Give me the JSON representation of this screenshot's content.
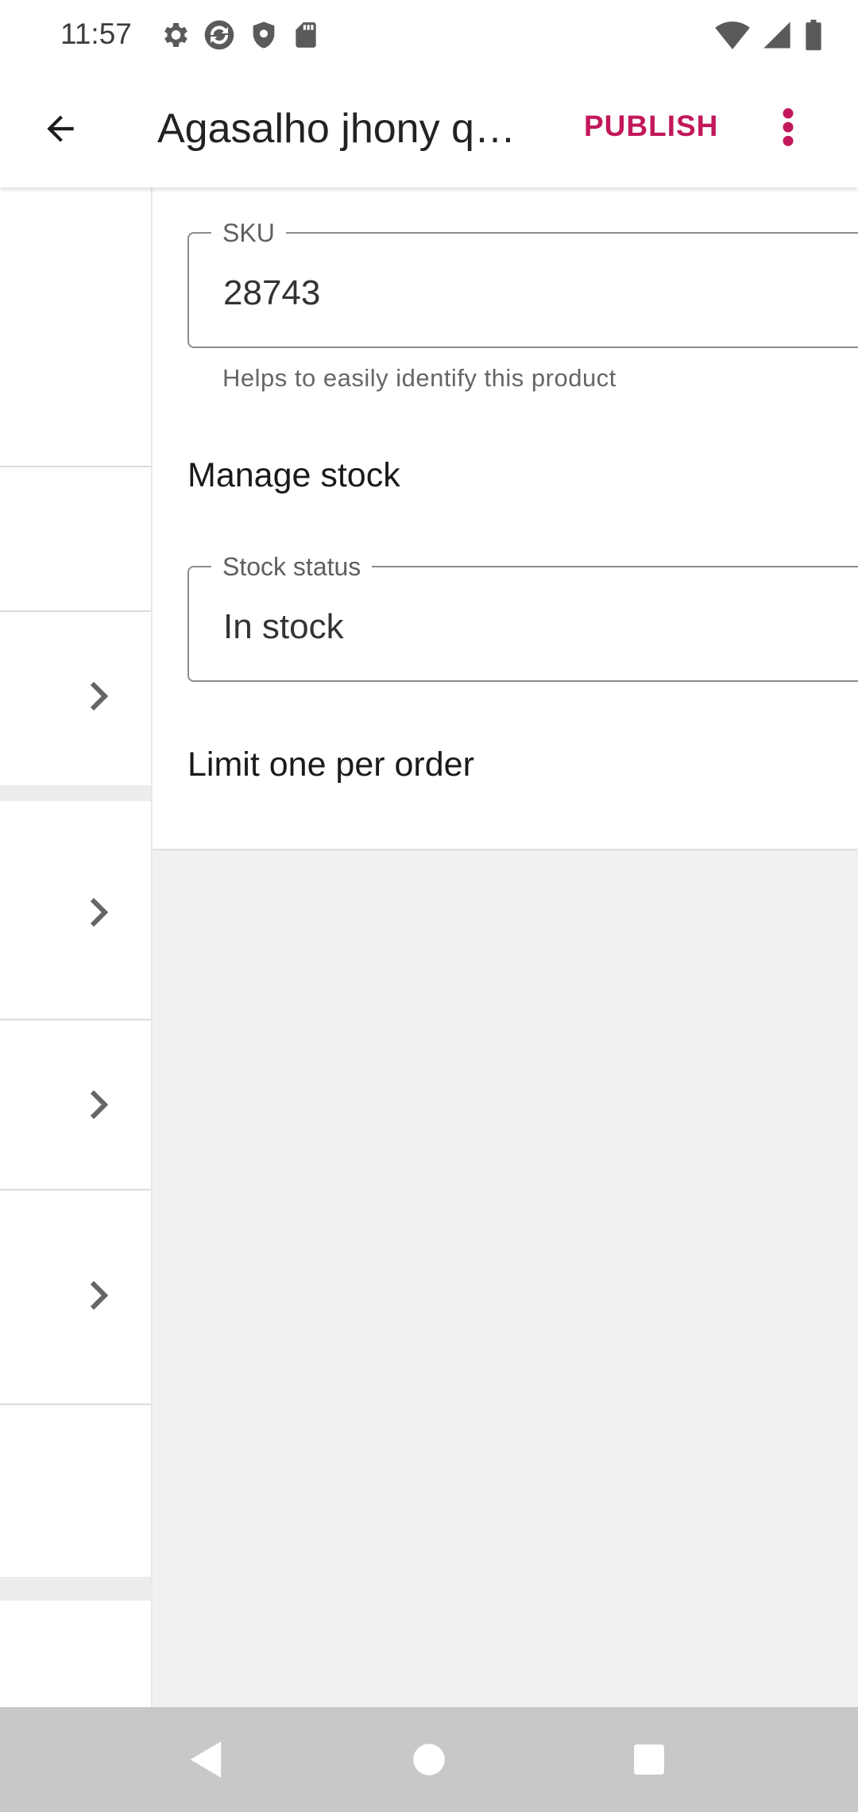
{
  "status_bar": {
    "time": "11:57",
    "left_icons": [
      "gear-icon",
      "sync-icon",
      "shield-icon",
      "sd-card-icon"
    ],
    "right_icons": [
      "wifi-icon",
      "signal-icon",
      "battery-icon"
    ]
  },
  "app_bar": {
    "back_icon": "arrow-back-icon",
    "title": "Agasalho jhony q…",
    "publish_label": "PUBLISH",
    "overflow_icon": "more-vert-icon",
    "accent_color": "#c2185b"
  },
  "inventory": {
    "sku": {
      "label": "SKU",
      "value": "28743",
      "helper": "Helps to easily identify this product"
    },
    "manage_stock": {
      "label": "Manage stock"
    },
    "stock_status": {
      "label": "Stock status",
      "value": "In stock"
    },
    "limit_one": {
      "label": "Limit one per order"
    }
  },
  "left_panel": {
    "chevron_icon": "chevron-right-icon"
  },
  "nav_bar": {
    "back": "nav-back-icon",
    "home": "nav-home-icon",
    "recents": "nav-recents-icon"
  }
}
